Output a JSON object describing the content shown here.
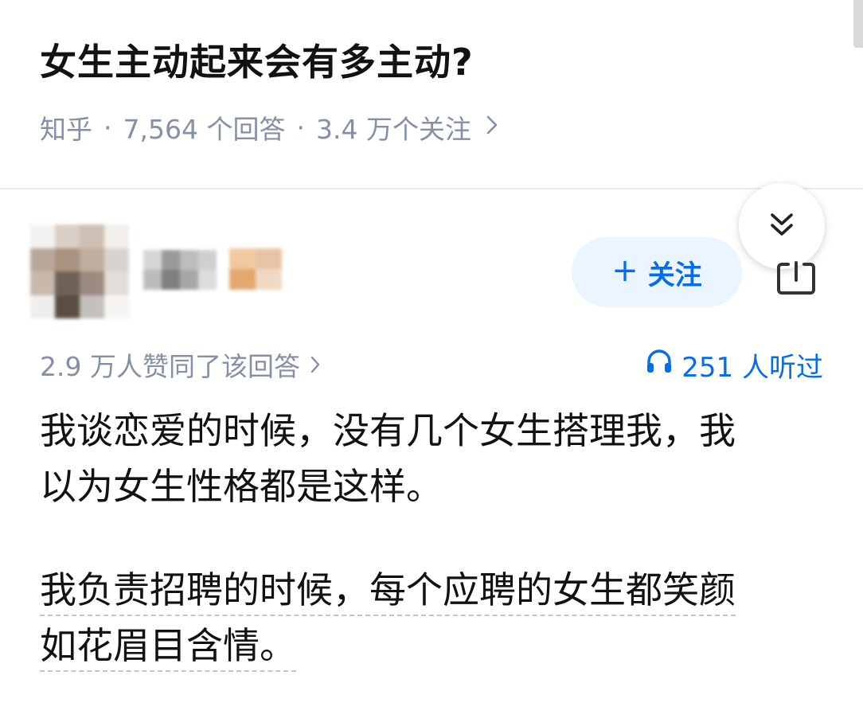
{
  "question": {
    "title": "女生主动起来会有多主动?",
    "source": "知乎",
    "answers": "7,564 个回答",
    "followers": "3.4 万个关注",
    "separator": "·"
  },
  "answer": {
    "follow_button_label": "关注",
    "follow_button_plus": "+",
    "votes_text": "2.9 万人赞同了该回答",
    "listen_count": "251 人听过",
    "paragraphs": [
      [
        "我谈恋爱的时候，没有几个女生搭理我，我",
        "以为女生性格都是这样。"
      ],
      [
        "我负责招聘的时候，每个应聘的女生都笑颜",
        "如花眉目含情。"
      ]
    ]
  },
  "icons": {
    "collapse": "double-chevron-down-icon",
    "share": "share-icon",
    "headphones": "headphones-icon",
    "chevron": "chevron-right-icon"
  },
  "colors": {
    "accent": "#056de8",
    "follow_bg": "#ebf5ff",
    "meta_gray": "#8590a6"
  }
}
